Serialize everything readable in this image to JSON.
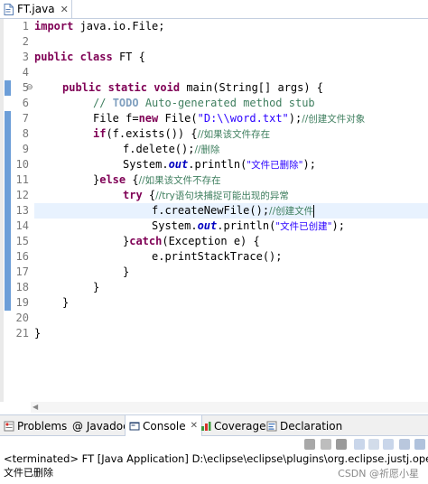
{
  "editor_tab": {
    "title": "FT.java",
    "close": "✕",
    "icon": "java-file-icon"
  },
  "line_numbers": [
    "1",
    "2",
    "3",
    "4",
    "5",
    "6",
    "7",
    "8",
    "9",
    "10",
    "11",
    "12",
    "13",
    "14",
    "15",
    "16",
    "17",
    "18",
    "19",
    "20",
    "21"
  ],
  "code": {
    "l1": {
      "kw": "import",
      "rest": " java.io.File;"
    },
    "l3": {
      "kw1": "public",
      "kw2": "class",
      "rest": " FT {"
    },
    "l5": {
      "kw1": "public",
      "kw2": "static",
      "kw3": "void",
      "rest": " main(String[] args) {"
    },
    "l6": {
      "cmt": "// ",
      "todo": "TODO",
      "rest": " Auto-generated method stub"
    },
    "l7": {
      "a": "File f=",
      "kw": "new",
      "b": " File(",
      "str": "\"D:\\\\word.txt\"",
      "c": ");",
      "cmt": "//创建文件对象"
    },
    "l8": {
      "kw": "if",
      "a": "(f.exists()) {",
      "cmt": "//如果该文件存在"
    },
    "l9": {
      "a": "f.delete();",
      "cmt": "//删除"
    },
    "l10": {
      "a": "System.",
      "fld": "out",
      "b": ".println(",
      "str": "\"文件已删除\"",
      "c": ");"
    },
    "l11": {
      "a": "}",
      "kw": "else",
      "b": " {",
      "cmt": "//如果该文件不存在"
    },
    "l12": {
      "kw": "try",
      "a": " {",
      "cmt": "//try语句块捕捉可能出现的异常"
    },
    "l13": {
      "a": "f.createNewFile();",
      "cmt": "//创建文件"
    },
    "l14": {
      "a": "System.",
      "fld": "out",
      "b": ".println(",
      "str": "\"文件已创建\"",
      "c": ");"
    },
    "l15": {
      "a": "}",
      "kw": "catch",
      "b": "(Exception e) {"
    },
    "l16": {
      "a": "e.printStackTrace();"
    },
    "l17": {
      "a": "}"
    },
    "l18": {
      "a": "}"
    },
    "l19": {
      "a": "}"
    },
    "l21": {
      "a": "}"
    }
  },
  "panel": {
    "tabs": [
      {
        "label": "Problems",
        "icon": "problems-icon"
      },
      {
        "label": "@ Javadoc",
        "icon": "javadoc-icon"
      },
      {
        "label": "Console",
        "icon": "console-icon",
        "close": "✕"
      },
      {
        "label": "Coverage",
        "icon": "coverage-icon"
      },
      {
        "label": "Declaration",
        "icon": "declaration-icon"
      }
    ],
    "console_header": "<terminated> FT [Java Application] D:\\eclipse\\eclipse\\plugins\\org.eclipse.justj.openjdk.",
    "output": "文件已删除",
    "watermark": "CSDN @祈愿小星"
  },
  "colors": {
    "keyword": "#7f0055",
    "string": "#2a00ff",
    "comment": "#3f7f5f",
    "field": "#0000c0",
    "current_line": "#e8f2fe",
    "change_marker": "#6c9ed8"
  }
}
